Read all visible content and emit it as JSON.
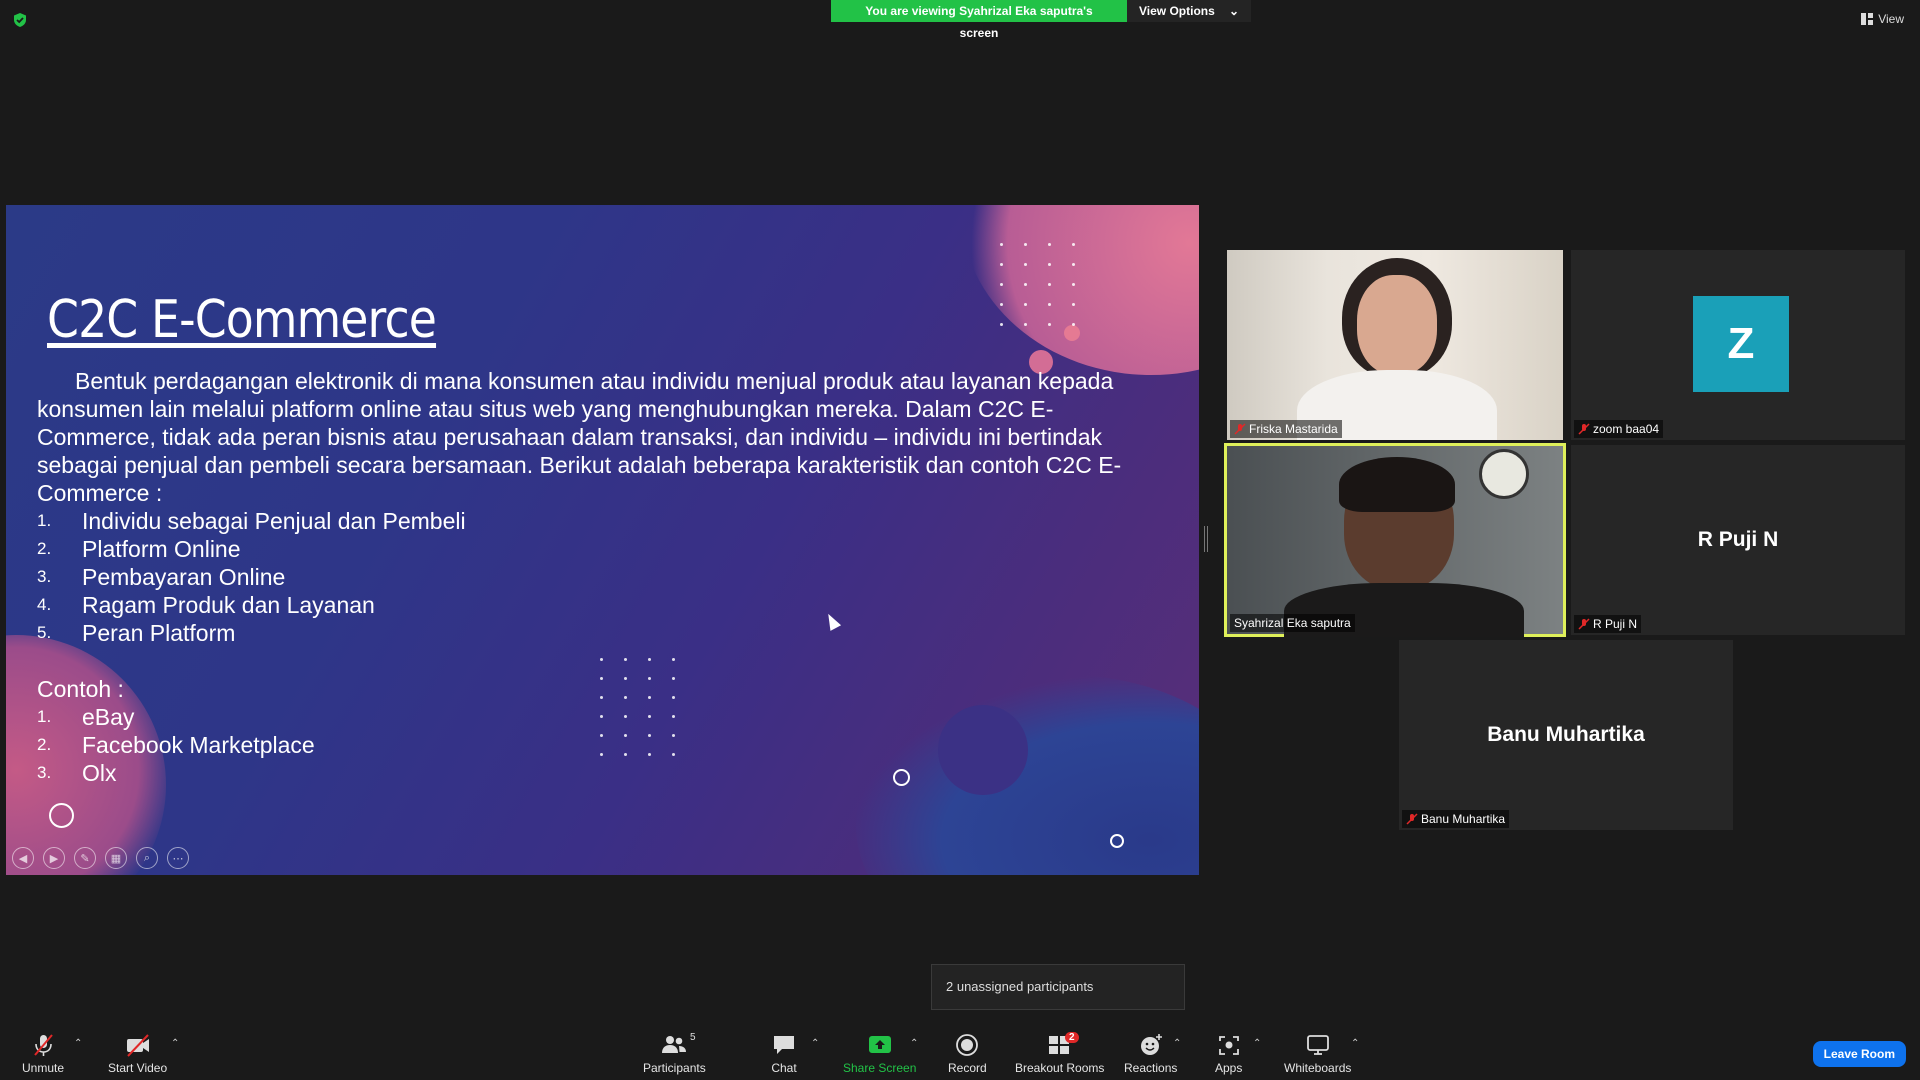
{
  "topbar": {
    "banner_text": "You are viewing Syahrizal Eka saputra's screen",
    "view_options_label": "View Options",
    "view_label": "View",
    "banner_color": "#22c247"
  },
  "slide": {
    "title": "C2C E-Commerce",
    "intro": "Bentuk perdagangan elektronik di mana konsumen atau individu menjual produk atau layanan kepada konsumen lain melalui platform online atau situs web yang menghubungkan mereka. Dalam C2C E-Commerce, tidak ada peran bisnis atau perusahaan dalam transaksi, dan individu – individu ini bertindak sebagai penjual dan pembeli secara bersamaan. Berikut adalah beberapa karakteristik dan contoh C2C E-Commerce :",
    "characteristics": [
      {
        "num": "1.",
        "text": "Individu sebagai Penjual dan Pembeli"
      },
      {
        "num": "2.",
        "text": "Platform Online"
      },
      {
        "num": "3.",
        "text": "Pembayaran Online"
      },
      {
        "num": "4.",
        "text": "Ragam Produk dan Layanan"
      },
      {
        "num": "5.",
        "text": "Peran Platform"
      }
    ],
    "examples_heading": "Contoh :",
    "examples": [
      {
        "num": "1.",
        "text": "eBay"
      },
      {
        "num": "2.",
        "text": "Facebook Marketplace"
      },
      {
        "num": "3.",
        "text": "Olx"
      }
    ]
  },
  "gallery": {
    "tiles": [
      {
        "name": "Friska Mastarida",
        "muted": true
      },
      {
        "name": "zoom baa04",
        "muted": true,
        "avatar_letter": "Z",
        "avatar_color": "#1aa0b8"
      },
      {
        "name": "Syahrizal Eka saputra",
        "muted": false,
        "active_speaker": true
      },
      {
        "name": "R Puji N",
        "muted": true,
        "display": "R Puji N"
      },
      {
        "name": "Banu Muhartika",
        "muted": true,
        "display": "Banu Muhartika"
      }
    ]
  },
  "tooltip": {
    "text": "2 unassigned participants"
  },
  "toolbar": {
    "unmute": "Unmute",
    "start_video": "Start Video",
    "participants": "Participants",
    "participants_count": "5",
    "chat": "Chat",
    "share_screen": "Share Screen",
    "record": "Record",
    "breakout_rooms": "Breakout Rooms",
    "breakout_badge": "2",
    "reactions": "Reactions",
    "apps": "Apps",
    "whiteboards": "Whiteboards",
    "leave_room": "Leave Room",
    "share_color": "#22c247",
    "leave_color": "#0e72ed"
  }
}
